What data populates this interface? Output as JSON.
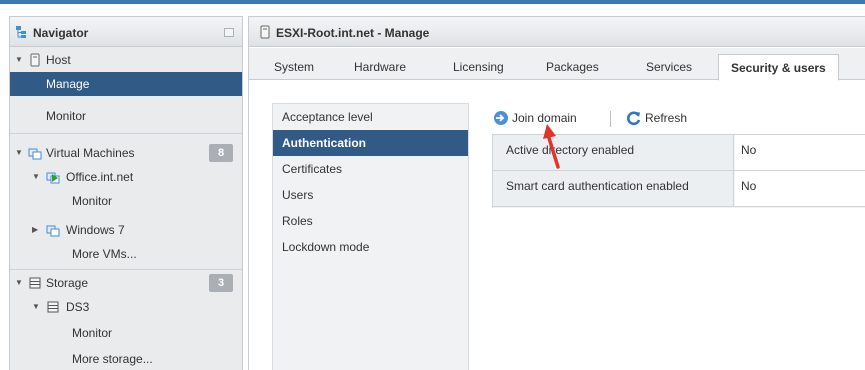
{
  "navigator": {
    "title": "Navigator",
    "items": [
      {
        "label": "Host"
      },
      {
        "label": "Manage"
      },
      {
        "label": "Monitor"
      },
      {
        "label": "Virtual Machines",
        "badge": "8"
      },
      {
        "label": "Office.int.net"
      },
      {
        "label": "Monitor"
      },
      {
        "label": "Windows 7"
      },
      {
        "label": "More VMs..."
      },
      {
        "label": "Storage",
        "badge": "3"
      },
      {
        "label": "DS3"
      },
      {
        "label": "Monitor"
      },
      {
        "label": "More storage..."
      }
    ]
  },
  "main": {
    "title": "ESXI-Root.int.net - Manage",
    "tabs": [
      "System",
      "Hardware",
      "Licensing",
      "Packages",
      "Services",
      "Security & users"
    ],
    "active_tab": "Security & users",
    "subnav": [
      "Acceptance level",
      "Authentication",
      "Certificates",
      "Users",
      "Roles",
      "Lockdown mode"
    ],
    "selected_subnav": "Authentication",
    "toolbar": {
      "join_domain": "Join domain",
      "refresh": "Refresh"
    },
    "rows": [
      {
        "key": "Active directory enabled",
        "value": "No"
      },
      {
        "key": "Smart card authentication enabled",
        "value": "No"
      }
    ]
  },
  "colors": {
    "selection": "#315a86",
    "accent": "#3c78b4",
    "arrow": "#e0342b"
  }
}
